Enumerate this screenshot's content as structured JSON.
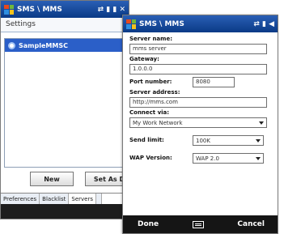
{
  "back_window": {
    "topbar": {
      "title": "SMS \\ MMS",
      "signal": "⇄ ▮ ▮ ✕"
    },
    "settings_title": "Settings",
    "list_items": [
      {
        "label": "SampleMMSC"
      }
    ],
    "buttons": {
      "new": "New",
      "set_as": "Set As D"
    },
    "tabs": [
      "Preferences",
      "Blacklist",
      "Servers",
      ""
    ]
  },
  "front_window": {
    "topbar": {
      "title": "SMS \\ MMS",
      "signal": "⇄ ▮ ◀"
    },
    "form": {
      "server_name_label": "Server name:",
      "server_name_value": "mms server",
      "gateway_label": "Gateway:",
      "gateway_value": "1.0.0.0",
      "port_label": "Port number:",
      "port_value": "8080",
      "server_address_label": "Server address:",
      "server_address_value": "http://mms.com",
      "connect_via_label": "Connect via:",
      "connect_via_value": "My Work Network",
      "send_limit_label": "Send limit:",
      "send_limit_value": "100K",
      "wap_version_label": "WAP Version:",
      "wap_version_value": "WAP 2.0"
    },
    "softkeys": {
      "left": "Done",
      "right": "Cancel"
    }
  }
}
